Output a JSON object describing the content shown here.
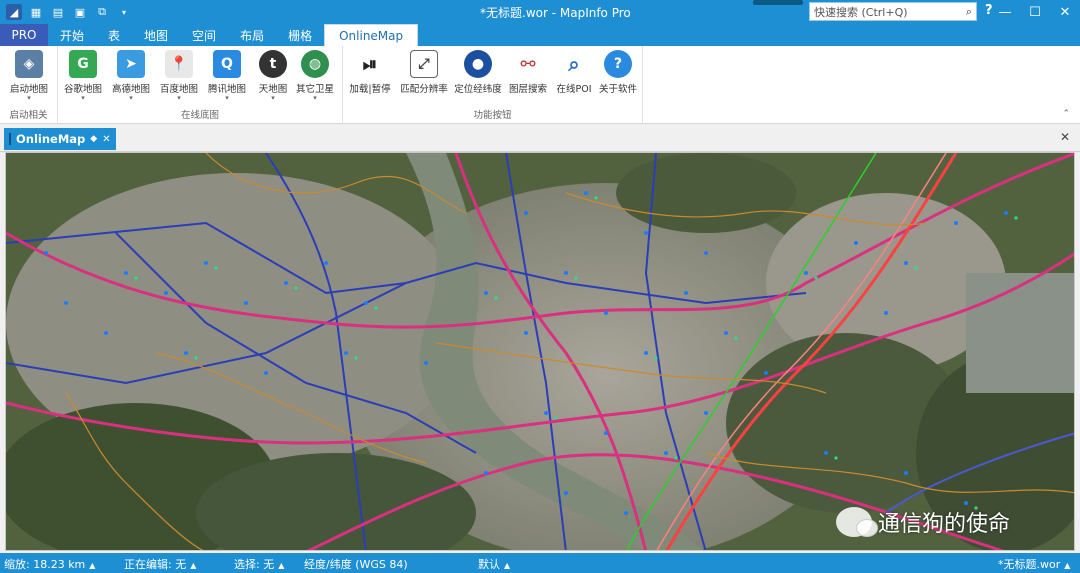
{
  "titlebar": {
    "title": "*无标题.wor - MapInfo Pro",
    "search_placeholder": "快速搜索 (Ctrl+Q)",
    "help": "?"
  },
  "tabs": [
    {
      "label": "PRO"
    },
    {
      "label": "开始"
    },
    {
      "label": "表"
    },
    {
      "label": "地图"
    },
    {
      "label": "空间"
    },
    {
      "label": "布局"
    },
    {
      "label": "栅格"
    },
    {
      "label": "OnlineMap"
    }
  ],
  "ribbon": {
    "groups": [
      {
        "label": "启动相关",
        "buttons": [
          {
            "label": "启动地图",
            "icon": "map-launch-icon"
          }
        ]
      },
      {
        "label": "在线底图",
        "buttons": [
          {
            "label": "谷歌地图",
            "icon": "google-maps-icon"
          },
          {
            "label": "高德地图",
            "icon": "amap-icon"
          },
          {
            "label": "百度地图",
            "icon": "baidu-map-icon"
          },
          {
            "label": "腾讯地图",
            "icon": "tencent-map-icon"
          },
          {
            "label": "天地图",
            "icon": "tianditu-icon"
          },
          {
            "label": "其它卫星",
            "icon": "globe-icon"
          }
        ]
      },
      {
        "label": "功能按钮",
        "buttons": [
          {
            "label": "加载|暂停",
            "icon": "play-pause-icon"
          },
          {
            "label": "匹配分辨率",
            "icon": "resolution-icon"
          },
          {
            "label": "定位经纬度",
            "icon": "locate-globe-icon"
          },
          {
            "label": "图层搜索",
            "icon": "binoculars-icon"
          },
          {
            "label": "在线POI",
            "icon": "search-icon"
          },
          {
            "label": "关于软件",
            "icon": "help-icon"
          }
        ]
      }
    ]
  },
  "document_tab": {
    "label": "OnlineMap"
  },
  "watermark": {
    "text": "通信狗的使命"
  },
  "statusbar": {
    "zoom": "缩放: 18.23 km",
    "editing": "正在编辑: 无",
    "selection": "选择: 无",
    "projection": "经度/纬度 (WGS 84)",
    "default": "默认",
    "workspace": "*无标题.wor"
  }
}
